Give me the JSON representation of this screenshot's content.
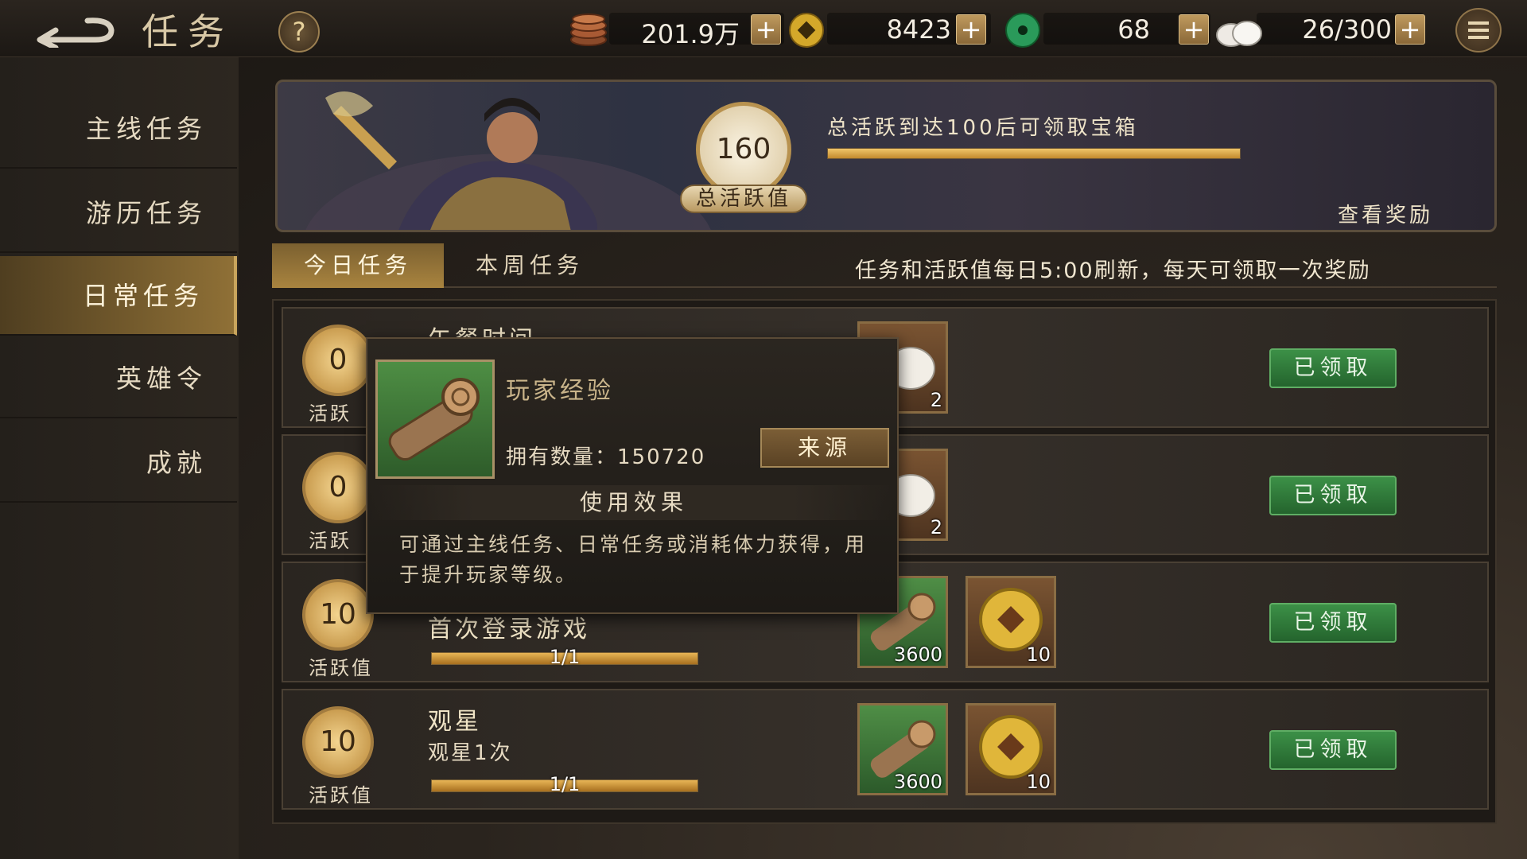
{
  "header": {
    "title": "任务",
    "help_label": "?",
    "resources": [
      {
        "name": "copper-coins",
        "value": "201.9万",
        "plus": "+"
      },
      {
        "name": "gold-ingot",
        "value": "8423",
        "plus": "+"
      },
      {
        "name": "jade-coin",
        "value": "68",
        "plus": "+"
      },
      {
        "name": "stamina-bun",
        "value": "26/300",
        "plus": "+"
      }
    ]
  },
  "sidebar": {
    "items": [
      {
        "label": "主线任务",
        "active": false
      },
      {
        "label": "游历任务",
        "active": false
      },
      {
        "label": "日常任务",
        "active": true
      },
      {
        "label": "英雄令",
        "active": false
      },
      {
        "label": "成就",
        "active": false
      }
    ]
  },
  "banner": {
    "activity_value": "160",
    "activity_label": "总活跃值",
    "progress_text": "总活跃到达100后可领取宝箱",
    "progress": 1.0,
    "chest_label": "查看奖励"
  },
  "tabs": [
    {
      "label": "今日任务",
      "active": true
    },
    {
      "label": "本周任务",
      "active": false
    }
  ],
  "notice": "任务和活跃值每日5:00刷新，每天可领取一次奖励",
  "tasks": [
    {
      "points": "0",
      "points_label": "活跃",
      "name": "午餐时间",
      "desc": "",
      "progress_text": "",
      "progress": 0,
      "rewards": [
        {
          "type": "bun",
          "count": "2"
        }
      ],
      "button": "已领取"
    },
    {
      "points": "0",
      "points_label": "活跃",
      "name": "",
      "desc": "",
      "progress_text": "",
      "progress": 0,
      "rewards": [
        {
          "type": "bun",
          "count": "2"
        }
      ],
      "button": "已领取"
    },
    {
      "points": "10",
      "points_label": "活跃值",
      "name": "首次登录游戏",
      "desc": "",
      "progress_text": "1/1",
      "progress": 1.0,
      "rewards": [
        {
          "type": "exp-scroll",
          "count": "3600"
        },
        {
          "type": "gold-coin",
          "count": "10"
        }
      ],
      "button": "已领取"
    },
    {
      "points": "10",
      "points_label": "活跃值",
      "name": "观星",
      "desc": "观星1次",
      "progress_text": "1/1",
      "progress": 1.0,
      "rewards": [
        {
          "type": "exp-scroll",
          "count": "3600"
        },
        {
          "type": "gold-coin",
          "count": "10"
        }
      ],
      "button": "已领取"
    }
  ],
  "popup": {
    "item_name": "玩家经验",
    "count_label": "拥有数量：",
    "count_value": "150720",
    "source_button": "来源",
    "effect_title": "使用效果",
    "description": "可通过主线任务、日常任务或消耗体力获得，用于提升玩家等级。"
  },
  "colors": {
    "accent": "#c9a55c",
    "claim_green": "#2f7a38",
    "bar_fill": "#d9a347"
  }
}
